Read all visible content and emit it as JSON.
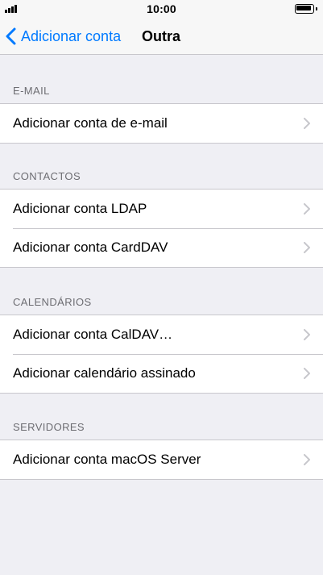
{
  "status_bar": {
    "time": "10:00",
    "signal_icon": "cellular-signal-icon",
    "battery_icon": "battery-full-icon"
  },
  "nav": {
    "back_label": "Adicionar conta",
    "back_icon": "chevron-left-icon",
    "title": "Outra"
  },
  "colors": {
    "accent": "#007aff",
    "background": "#efeff4",
    "section_header": "#6d6d72",
    "separator": "#c8c7cc",
    "chevron": "#c7c7cc"
  },
  "sections": [
    {
      "header": "E-MAIL",
      "items": [
        {
          "label": "Adicionar conta de e-mail"
        }
      ]
    },
    {
      "header": "CONTACTOS",
      "items": [
        {
          "label": "Adicionar conta LDAP"
        },
        {
          "label": "Adicionar conta CardDAV"
        }
      ]
    },
    {
      "header": "CALENDÁRIOS",
      "items": [
        {
          "label": "Adicionar conta CalDAV…"
        },
        {
          "label": "Adicionar calendário assinado"
        }
      ]
    },
    {
      "header": "SERVIDORES",
      "items": [
        {
          "label": "Adicionar conta macOS Server"
        }
      ]
    }
  ]
}
